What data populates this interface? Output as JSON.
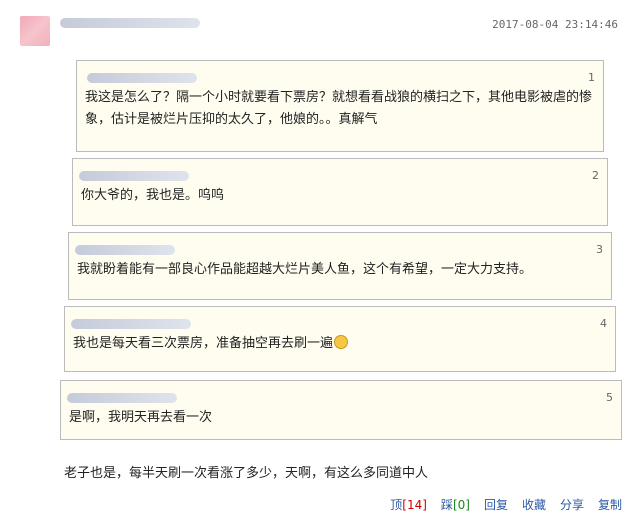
{
  "post": {
    "timestamp": "2017-08-04 23:14:46",
    "reply_text": "老子也是，每半天刷一次看涨了多少，天啊，有这么多同道中人"
  },
  "quotes": [
    {
      "floor": "1",
      "text_line1": "我这是怎么了？隔一个小时就要看下票房？就想看看战狼的横扫之下，其他电影被虐的惨",
      "text_line2": "象，估计是被烂片压抑的太久了，他娘的。。真解气"
    },
    {
      "floor": "2",
      "text": "你大爷的，我也是。呜呜"
    },
    {
      "floor": "3",
      "text": "我就盼着能有一部良心作品能超越大烂片美人鱼，这个有希望，一定大力支持。"
    },
    {
      "floor": "4",
      "text": "我也是每天看三次票房，准备抽空再去刷一遍"
    },
    {
      "floor": "5",
      "text": "是啊，我明天再去看一次"
    }
  ],
  "actions": {
    "top_label": "顶",
    "top_count": "[14]",
    "down_label": "踩",
    "down_count": "[0]",
    "reply": "回复",
    "favorite": "收藏",
    "share": "分享",
    "copy": "复制"
  }
}
